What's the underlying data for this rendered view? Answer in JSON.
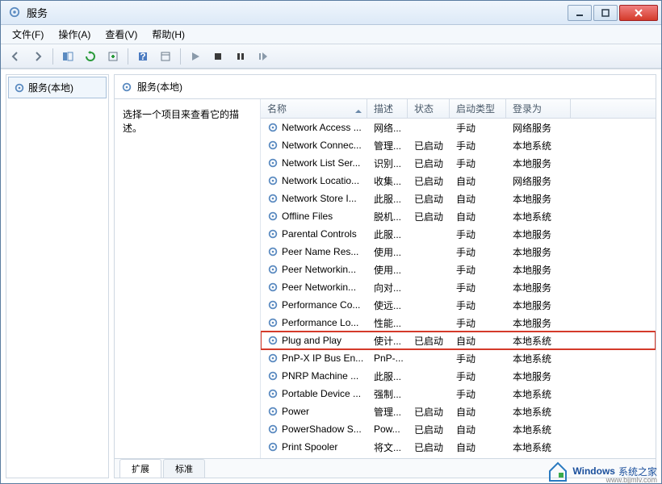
{
  "window": {
    "title": "服务"
  },
  "menu": {
    "file": "文件(F)",
    "action": "操作(A)",
    "view": "查看(V)",
    "help": "帮助(H)"
  },
  "tree": {
    "root": "服务(本地)"
  },
  "panel": {
    "heading": "服务(本地)",
    "prompt": "选择一个项目来查看它的描述。"
  },
  "columns": {
    "name": "名称",
    "desc": "描述",
    "status": "状态",
    "startup": "启动类型",
    "logon": "登录为"
  },
  "tabs": {
    "extended": "扩展",
    "standard": "标准"
  },
  "services": [
    {
      "name": "Network Access ...",
      "desc": "网络...",
      "status": "",
      "startup": "手动",
      "logon": "网络服务"
    },
    {
      "name": "Network Connec...",
      "desc": "管理...",
      "status": "已启动",
      "startup": "手动",
      "logon": "本地系统"
    },
    {
      "name": "Network List Ser...",
      "desc": "识别...",
      "status": "已启动",
      "startup": "手动",
      "logon": "本地服务"
    },
    {
      "name": "Network Locatio...",
      "desc": "收集...",
      "status": "已启动",
      "startup": "自动",
      "logon": "网络服务"
    },
    {
      "name": "Network Store I...",
      "desc": "此服...",
      "status": "已启动",
      "startup": "自动",
      "logon": "本地服务"
    },
    {
      "name": "Offline Files",
      "desc": "脱机...",
      "status": "已启动",
      "startup": "自动",
      "logon": "本地系统"
    },
    {
      "name": "Parental Controls",
      "desc": "此服...",
      "status": "",
      "startup": "手动",
      "logon": "本地服务"
    },
    {
      "name": "Peer Name Res...",
      "desc": "使用...",
      "status": "",
      "startup": "手动",
      "logon": "本地服务"
    },
    {
      "name": "Peer Networkin...",
      "desc": "使用...",
      "status": "",
      "startup": "手动",
      "logon": "本地服务"
    },
    {
      "name": "Peer Networkin...",
      "desc": "向对...",
      "status": "",
      "startup": "手动",
      "logon": "本地服务"
    },
    {
      "name": "Performance Co...",
      "desc": "使远...",
      "status": "",
      "startup": "手动",
      "logon": "本地服务"
    },
    {
      "name": "Performance Lo...",
      "desc": "性能...",
      "status": "",
      "startup": "手动",
      "logon": "本地服务"
    },
    {
      "name": "Plug and Play",
      "desc": "使计...",
      "status": "已启动",
      "startup": "自动",
      "logon": "本地系统",
      "highlight": true
    },
    {
      "name": "PnP-X IP Bus En...",
      "desc": "PnP-...",
      "status": "",
      "startup": "手动",
      "logon": "本地系统"
    },
    {
      "name": "PNRP Machine ...",
      "desc": "此服...",
      "status": "",
      "startup": "手动",
      "logon": "本地服务"
    },
    {
      "name": "Portable Device ...",
      "desc": "强制...",
      "status": "",
      "startup": "手动",
      "logon": "本地系统"
    },
    {
      "name": "Power",
      "desc": "管理...",
      "status": "已启动",
      "startup": "自动",
      "logon": "本地系统"
    },
    {
      "name": "PowerShadow S...",
      "desc": "Pow...",
      "status": "已启动",
      "startup": "自动",
      "logon": "本地系统"
    },
    {
      "name": "Print Spooler",
      "desc": "将文...",
      "status": "已启动",
      "startup": "自动",
      "logon": "本地系统"
    }
  ],
  "watermark": {
    "brand": "Windows",
    "suffix": "系统之家",
    "url": "www.bjjmlv.com"
  }
}
